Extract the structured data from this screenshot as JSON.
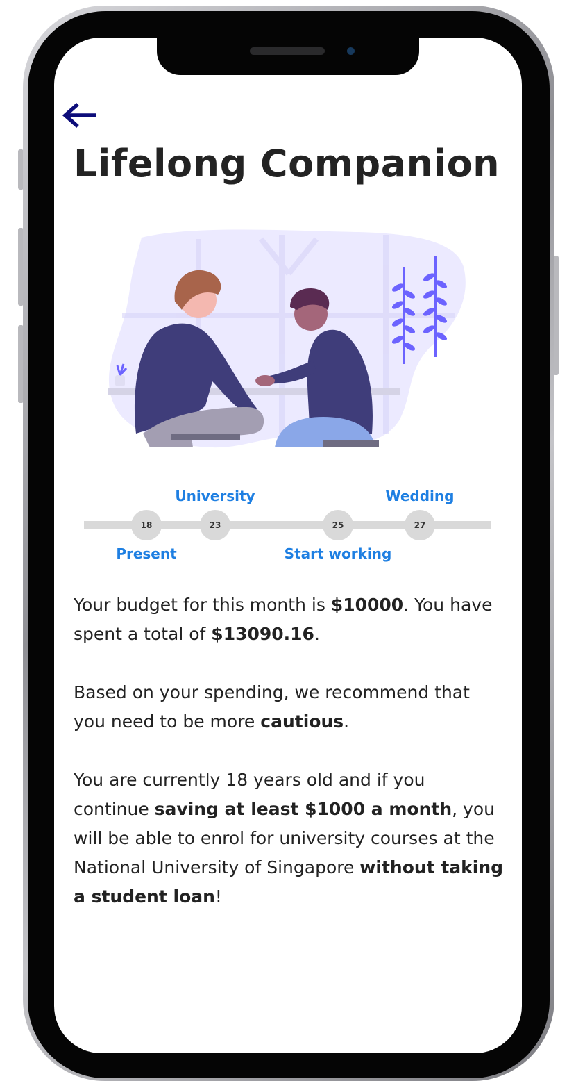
{
  "app": {
    "title": "Lifelong Companion"
  },
  "timeline": {
    "nodes": [
      {
        "age": "18",
        "label": "Present",
        "label_position": "bottom"
      },
      {
        "age": "23",
        "label": "University",
        "label_position": "top"
      },
      {
        "age": "25",
        "label": "Start working",
        "label_position": "bottom"
      },
      {
        "age": "27",
        "label": "Wedding",
        "label_position": "top"
      }
    ]
  },
  "summary": {
    "budget_prefix": "Your budget for this month is ",
    "budget_amount": "$10000",
    "budget_mid": ". You have spent a total of ",
    "spent_amount": "$13090.16",
    "budget_suffix": ".",
    "rec_prefix": "Based on your spending, we recommend that you need to be more ",
    "rec_word": "cautious",
    "rec_suffix": ".",
    "goal_prefix": "You are currently 18 years old and if you continue ",
    "goal_saving": "saving at least $1000 a month",
    "goal_mid": ", you will be able to enrol for university courses at the National University of Singapore ",
    "goal_loan": "without taking a student loan",
    "goal_suffix": "!"
  },
  "colors": {
    "accent": "#1e7fe2",
    "back_arrow": "#0d0d7a",
    "title": "#232323",
    "timeline_track": "#d9d9d9"
  },
  "icons": {
    "back": "arrow-left-icon"
  }
}
